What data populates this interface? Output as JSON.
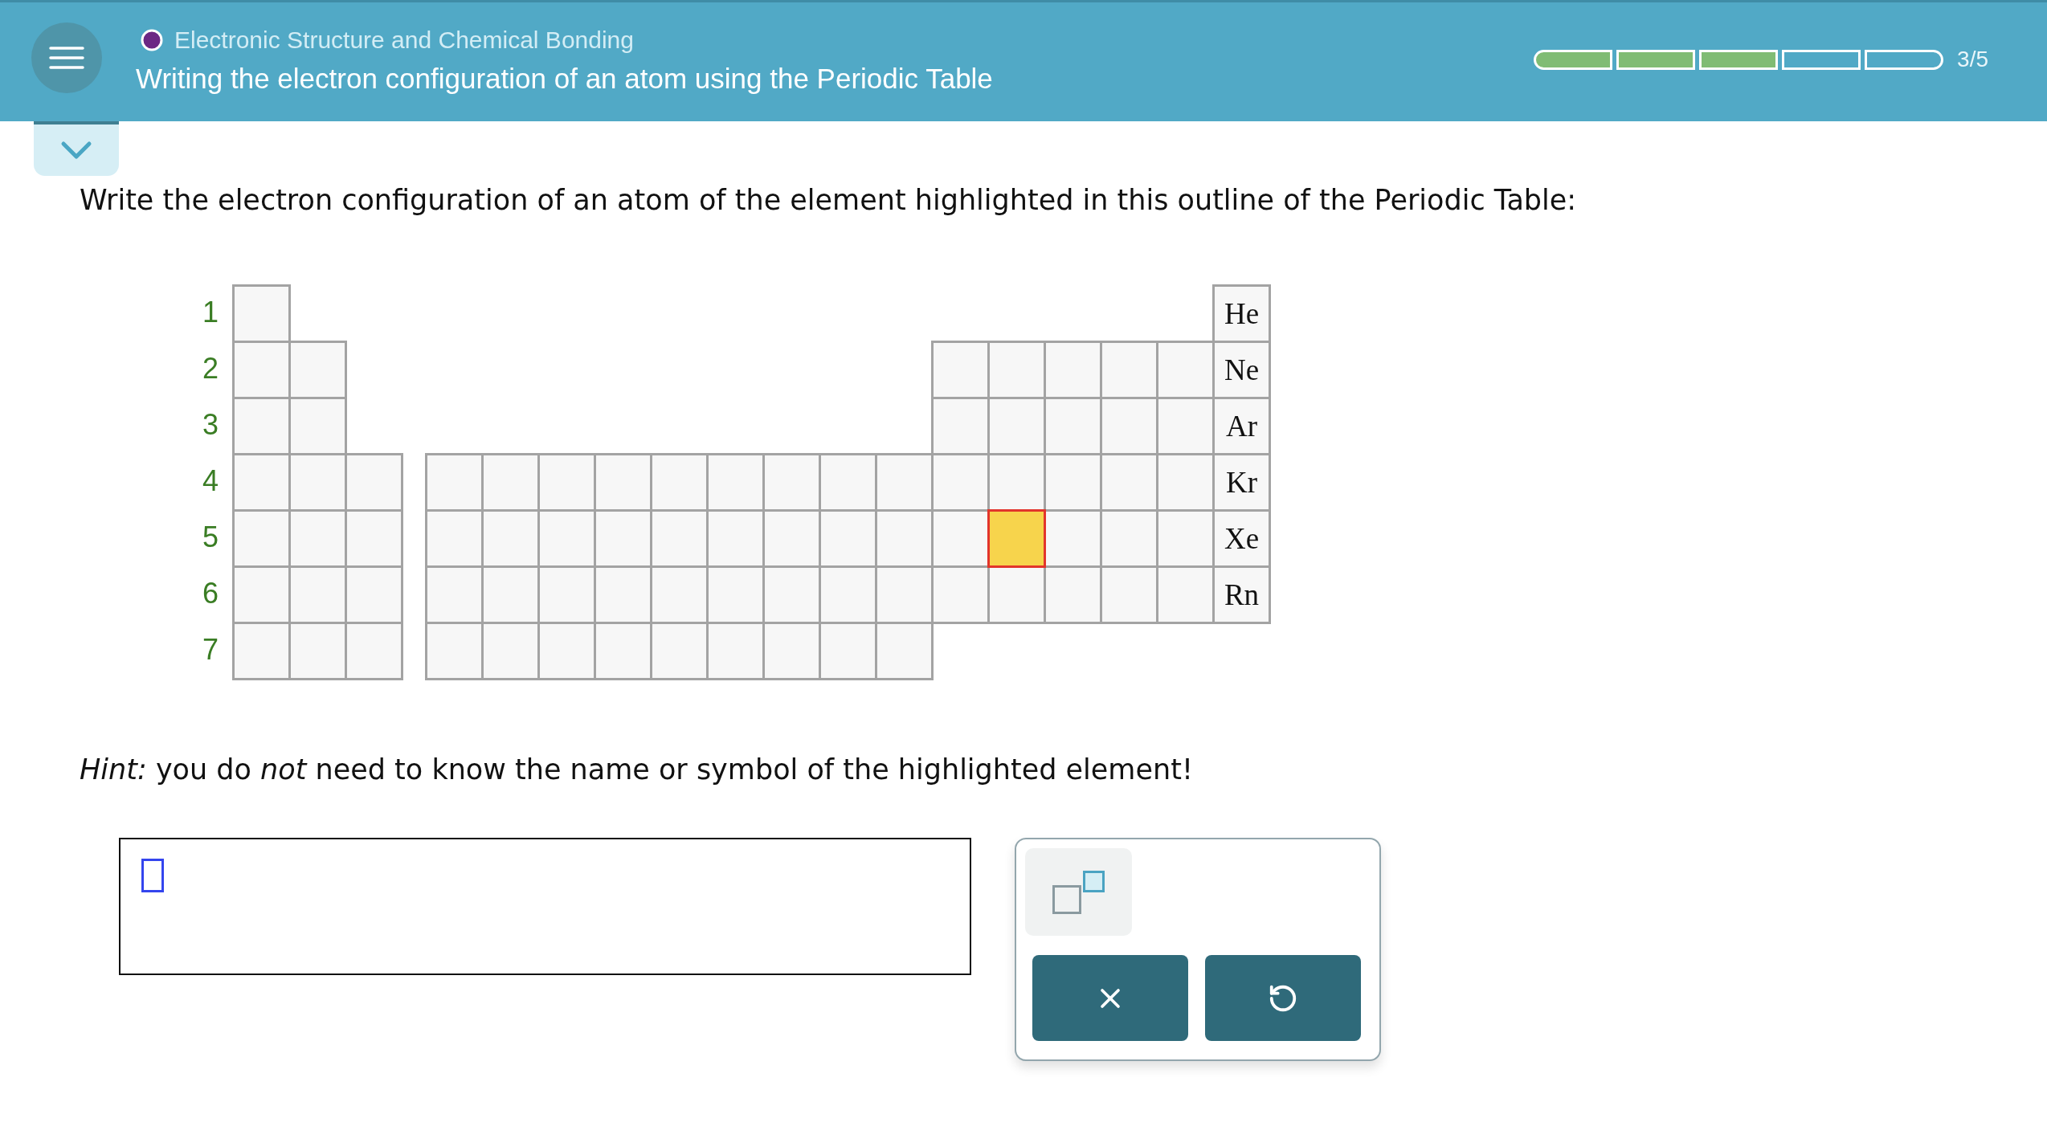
{
  "header": {
    "category": "Electronic Structure and Chemical Bonding",
    "title": "Writing the electron configuration of an atom using the Periodic Table",
    "progress": {
      "segments": [
        {
          "completed": true
        },
        {
          "completed": true
        },
        {
          "completed": true
        },
        {
          "completed": false
        },
        {
          "completed": false
        }
      ],
      "reading": "3/5"
    }
  },
  "question": {
    "prompt": "Write the electron configuration of an atom of the element highlighted in this outline of the Periodic Table:",
    "hint": "*Hint:* you do *not* need to know the name or symbol of the highlighted element!"
  },
  "periodic_table": {
    "rows": [
      {
        "label": "1",
        "cells": [
          {
            "highlighted": false
          },
          {
            "symbol": "He",
            "highlighted": false
          }
        ]
      },
      {
        "label": "2",
        "cells": [
          {
            "highlighted": false
          },
          {
            "highlighted": false
          },
          {
            "highlighted": false
          },
          {
            "highlighted": false
          },
          {
            "highlighted": false
          },
          {
            "highlighted": false
          },
          {
            "highlighted": false
          },
          {
            "symbol": "Ne",
            "highlighted": false
          }
        ]
      },
      {
        "label": "3",
        "cells": [
          {
            "highlighted": false
          },
          {
            "highlighted": false
          },
          {
            "highlighted": false
          },
          {
            "highlighted": false
          },
          {
            "highlighted": false
          },
          {
            "highlighted": false
          },
          {
            "highlighted": false
          },
          {
            "symbol": "Ar",
            "highlighted": false
          }
        ]
      },
      {
        "label": "4",
        "cells": [
          {
            "highlighted": false
          },
          {
            "highlighted": false
          },
          {
            "highlighted": false
          },
          {
            "highlighted": false
          },
          {
            "highlighted": false
          },
          {
            "highlighted": false
          },
          {
            "highlighted": false
          },
          {
            "highlighted": false
          },
          {
            "highlighted": false
          },
          {
            "highlighted": false
          },
          {
            "highlighted": false
          },
          {
            "highlighted": false
          },
          {
            "highlighted": false
          },
          {
            "highlighted": false
          },
          {
            "highlighted": false
          },
          {
            "highlighted": false
          },
          {
            "highlighted": false
          },
          {
            "symbol": "Kr",
            "highlighted": false
          }
        ]
      },
      {
        "label": "5",
        "cells": [
          {
            "highlighted": false
          },
          {
            "highlighted": false
          },
          {
            "highlighted": false
          },
          {
            "highlighted": false
          },
          {
            "highlighted": false
          },
          {
            "highlighted": false
          },
          {
            "highlighted": false
          },
          {
            "highlighted": false
          },
          {
            "highlighted": false
          },
          {
            "highlighted": false
          },
          {
            "highlighted": false
          },
          {
            "highlighted": false
          },
          {
            "highlighted": false
          },
          {
            "highlighted": true
          },
          {
            "highlighted": false
          },
          {
            "highlighted": false
          },
          {
            "highlighted": false
          },
          {
            "symbol": "Xe",
            "highlighted": false
          }
        ]
      },
      {
        "label": "6",
        "cells": [
          {
            "highlighted": false
          },
          {
            "highlighted": false
          },
          {
            "highlighted": false
          },
          {
            "highlighted": false
          },
          {
            "highlighted": false
          },
          {
            "highlighted": false
          },
          {
            "highlighted": false
          },
          {
            "highlighted": false
          },
          {
            "highlighted": false
          },
          {
            "highlighted": false
          },
          {
            "highlighted": false
          },
          {
            "highlighted": false
          },
          {
            "highlighted": false
          },
          {
            "highlighted": false
          },
          {
            "highlighted": false
          },
          {
            "highlighted": false
          },
          {
            "highlighted": false
          },
          {
            "symbol": "Rn",
            "highlighted": false
          }
        ]
      },
      {
        "label": "7",
        "cells": [
          {
            "highlighted": false
          },
          {
            "highlighted": false
          },
          {
            "highlighted": false
          },
          {
            "highlighted": false
          },
          {
            "highlighted": false
          },
          {
            "highlighted": false
          },
          {
            "highlighted": false
          },
          {
            "highlighted": false
          },
          {
            "highlighted": false
          },
          {
            "highlighted": false
          },
          {
            "highlighted": false
          },
          {
            "highlighted": false
          }
        ]
      }
    ]
  },
  "palette": {
    "templates": [
      {
        "kind": "superscript"
      }
    ],
    "actions": [
      {
        "kind": "clear"
      },
      {
        "kind": "undo"
      }
    ]
  }
}
